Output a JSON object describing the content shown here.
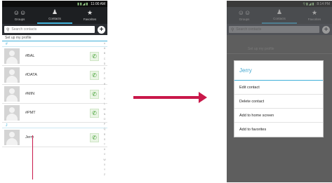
{
  "left_phone": {
    "status_time": "11:00 AM",
    "tabs": [
      {
        "label": "Groups",
        "icon": "groups-icon"
      },
      {
        "label": "Contacts",
        "icon": "contacts-icon"
      },
      {
        "label": "Favorites",
        "icon": "star-icon"
      }
    ],
    "search_placeholder": "Search contacts",
    "profile_label": "Set up my profile",
    "section_letters": [
      "#",
      "J"
    ],
    "contacts": [
      "#BAL",
      "#DATA",
      "#MIN",
      "#PMT",
      "Jerry"
    ],
    "index_letters": [
      "#",
      "A",
      "B",
      "C",
      "D",
      "E",
      "F",
      "G",
      "H",
      "I",
      "J",
      "K",
      "L",
      "M",
      "N",
      "O",
      "P",
      "Q",
      "R",
      "S",
      "T",
      "U",
      "V",
      "W",
      "X",
      "Y",
      "Z"
    ]
  },
  "right_phone": {
    "status_time": "8:14 PM",
    "tabs": [
      {
        "label": "Groups",
        "icon": "groups-icon"
      },
      {
        "label": "Contacts",
        "icon": "contacts-icon"
      },
      {
        "label": "Favorites",
        "icon": "star-icon"
      }
    ],
    "search_placeholder": "Search contacts",
    "background_row": "Set up my profile",
    "menu": {
      "title": "Jerry",
      "items": [
        "Edit contact",
        "Delete contact",
        "Add to home screen",
        "Add to favorites"
      ]
    }
  },
  "colors": {
    "accent": "#3fb0d9",
    "arrow": "#c9184a",
    "call_green": "#3e9e2f"
  }
}
